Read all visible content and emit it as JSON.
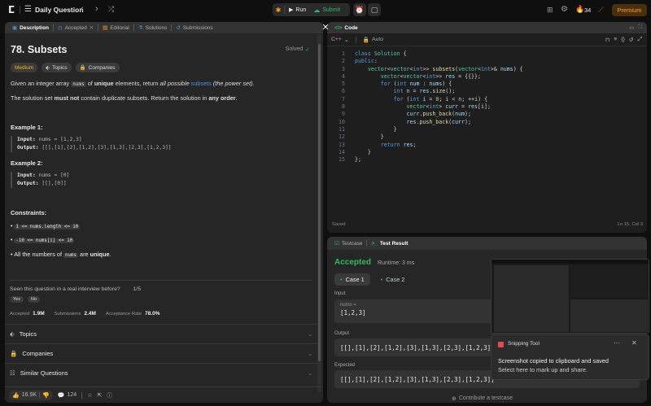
{
  "topbar": {
    "title": "Daily Question",
    "run": "Run",
    "submit": "Submit",
    "streak": "34",
    "premium": "Premium"
  },
  "colors": {
    "accent": "#ffa116",
    "green": "#2cbb5d",
    "premium_bg": "#4a2f0b",
    "premium_text": "#ffa116"
  },
  "left_tabs": [
    "Description",
    "Accepted",
    "Editorial",
    "Solutions",
    "Submissions"
  ],
  "problem": {
    "title": "78. Subsets",
    "status": "Solved",
    "difficulty": "Medium",
    "topics_pill": "Topics",
    "companies_pill": "Companies",
    "desc1_a": "Given an integer array ",
    "desc1_code": "nums",
    "desc1_b": " of ",
    "desc1_bold": "unique",
    "desc1_c": " elements, return ",
    "desc1_it": "all possible",
    "desc1_link": "subsets",
    "desc1_d": " (the power set).",
    "desc2_a": "The solution set ",
    "desc2_bold": "must not",
    "desc2_b": " contain duplicate subsets. Return the solution in ",
    "desc2_bold2": "any order",
    "ex1_title": "Example 1:",
    "ex1_input_label": "Input:",
    "ex1_input": "nums = [1,2,3]",
    "ex1_output_label": "Output:",
    "ex1_output": "[[],[1],[2],[1,2],[3],[1,3],[2,3],[1,2,3]]",
    "ex2_title": "Example 2:",
    "ex2_input_label": "Input:",
    "ex2_input": "nums = [0]",
    "ex2_output_label": "Output:",
    "ex2_output": "[[],[0]]",
    "constraints_title": "Constraints:",
    "c1": "1 <= nums.length <= 10",
    "c2": "-10 <= nums[i] <= 10",
    "c3_a": "All the numbers of ",
    "c3_code": "nums",
    "c3_b": " are ",
    "c3_bold": "unique",
    "interview_q": "Seen this question in a real interview before?",
    "interview_page": "1/5",
    "yes": "Yes",
    "no": "No",
    "accepted_label": "Accepted",
    "accepted_val": "1.9M",
    "submissions_label": "Submissions",
    "submissions_val": "2.4M",
    "rate_label": "Acceptance Rate",
    "rate_val": "78.0%",
    "acc1": "Topics",
    "acc2": "Companies",
    "acc3": "Similar Questions",
    "likes": "16.9K",
    "comments": "124"
  },
  "code": {
    "tab": "Code",
    "lang": "C++",
    "mode": "Auto",
    "saved": "Saved",
    "cursor": "Ln 15, Col 3",
    "lines": [
      {
        "n": "1",
        "html": "<span class='kw'>class</span> <span class='ty'>Solution</span> <span class='pl'>{</span>"
      },
      {
        "n": "2",
        "html": "<span class='kw'>public</span><span class='pl'>:</span>"
      },
      {
        "n": "3",
        "html": "    <span class='ty'>vector</span><span class='pl'>&lt;</span><span class='ty'>vector</span><span class='pl'>&lt;</span><span class='kw'>int</span><span class='pl'>&gt;&gt;</span> <span class='fn'>subsets</span><span class='pl'>(</span><span class='ty'>vector</span><span class='pl'>&lt;</span><span class='kw'>int</span><span class='pl'>&gt;&amp;</span> <span class='vr'>nums</span><span class='pl'>) {</span>"
      },
      {
        "n": "4",
        "html": "        <span class='ty'>vector</span><span class='pl'>&lt;</span><span class='ty'>vector</span><span class='pl'>&lt;</span><span class='kw'>int</span><span class='pl'>&gt;&gt;</span> <span class='vr'>res</span> <span class='pl'>= {{}};</span>"
      },
      {
        "n": "5",
        "html": "        <span class='kw'>for</span> <span class='pl'>(</span><span class='kw'>int</span> <span class='vr'>num</span> <span class='pl'>:</span> <span class='vr'>nums</span><span class='pl'>) {</span>"
      },
      {
        "n": "6",
        "html": "            <span class='kw'>int</span> <span class='vr'>n</span> <span class='pl'>=</span> <span class='vr'>res</span><span class='pl'>.</span><span class='fn'>size</span><span class='pl'>();</span>"
      },
      {
        "n": "7",
        "html": "            <span class='kw'>for</span> <span class='pl'>(</span><span class='kw'>int</span> <span class='vr'>i</span> <span class='pl'>=</span> <span class='nm'>0</span><span class='pl'>;</span> <span class='vr'>i</span> <span class='pl'>&lt;</span> <span class='vr'>n</span><span class='pl'>; ++</span><span class='vr'>i</span><span class='pl'>) {</span>"
      },
      {
        "n": "8",
        "html": "                <span class='ty'>vector</span><span class='pl'>&lt;</span><span class='kw'>int</span><span class='pl'>&gt;</span> <span class='vr'>curr</span> <span class='pl'>=</span> <span class='vr'>res</span><span class='pl'>[</span><span class='vr'>i</span><span class='pl'>];</span>"
      },
      {
        "n": "9",
        "html": "                <span class='vr'>curr</span><span class='pl'>.</span><span class='fn'>push_back</span><span class='pl'>(</span><span class='vr'>num</span><span class='pl'>);</span>"
      },
      {
        "n": "10",
        "html": "                <span class='vr'>res</span><span class='pl'>.</span><span class='fn'>push_back</span><span class='pl'>(</span><span class='vr'>curr</span><span class='pl'>);</span>"
      },
      {
        "n": "11",
        "html": "            <span class='pl'>}</span>"
      },
      {
        "n": "12",
        "html": "        <span class='pl'>}</span>"
      },
      {
        "n": "13",
        "html": "        <span class='kw'>return</span> <span class='vr'>res</span><span class='pl'>;</span>"
      },
      {
        "n": "14",
        "html": "    <span class='pl'>}</span>"
      },
      {
        "n": "15",
        "html": "<span class='pl'>};</span>"
      }
    ]
  },
  "test": {
    "tab1": "Testcase",
    "tab2": "Test Result",
    "verdict": "Accepted",
    "runtime": "Runtime: 3 ms",
    "case1": "Case 1",
    "case2": "Case 2",
    "input_label": "Input",
    "var": "nums =",
    "input_val": "[1,2,3]",
    "output_label": "Output",
    "output_val": "[[],[1],[2],[1,2],[3],[1,3],[2,3],[1,2,3]]",
    "expected_label": "Expected",
    "expected_val": "[[],[1],[2],[1,2],[3],[1,3],[2,3],[1,2,3]]",
    "contribute": "Contribute a testcase"
  },
  "toast": {
    "app": "Snipping Tool",
    "msg1": "Screenshot copied to clipboard and saved",
    "msg2": "Select here to mark up and share."
  }
}
